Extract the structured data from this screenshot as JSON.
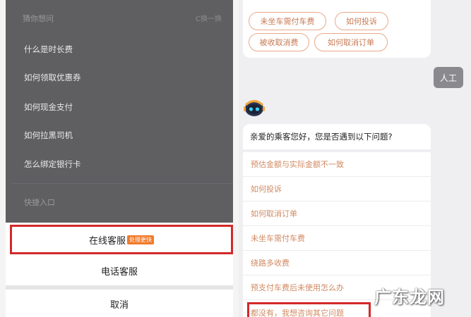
{
  "left": {
    "header_title": "猜你想问",
    "header_refresh": "C换一换",
    "faq": [
      "什么是时长费",
      "如何领取优惠券",
      "如何现金支付",
      "如何拉黑司机",
      "怎么绑定银行卡"
    ],
    "shortcut_label": "快捷入口",
    "sheet": {
      "online_label": "在线客服",
      "online_badge": "处理更快",
      "phone_label": "电话客服",
      "cancel_label": "取消"
    }
  },
  "right": {
    "top_chips": [
      "未坐车需付车费",
      "如何投诉",
      "被收取消费",
      "如何取消订单"
    ],
    "human_button": "人工",
    "greeting": "亲爱的乘客您好，您是否遇到以下问题?",
    "questions": [
      "预估金额与实际金额不一致",
      "如何投诉",
      "如何取消订单",
      "未坐车需付车费",
      "绕路多收费",
      "预支付车费后未使用怎么办",
      "都没有，我想咨询其它问题"
    ]
  },
  "watermark": "广东龙网",
  "colors": {
    "highlight": "#d3282a",
    "accent_text": "#d08a62",
    "badge": "#f07a2a",
    "overlay": "#5f5f62"
  }
}
